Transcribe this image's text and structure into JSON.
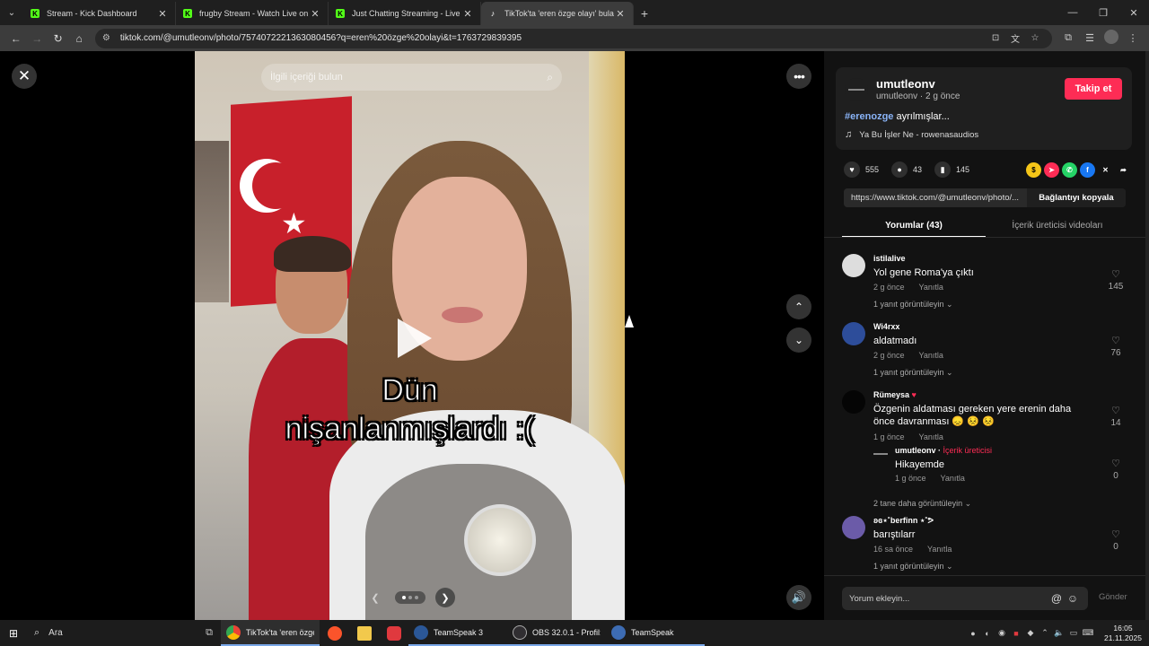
{
  "browser": {
    "tabs": [
      {
        "title": "Stream - Kick Dashboard",
        "favicon": "kick-icon",
        "active": false
      },
      {
        "title": "frugby Stream - Watch Live on",
        "favicon": "kick-icon",
        "active": false
      },
      {
        "title": "Just Chatting Streaming - Live",
        "favicon": "kick-icon",
        "active": false
      },
      {
        "title": "TikTok'ta 'eren özge olayı' bula",
        "favicon": "tiktok-icon",
        "active": true
      }
    ],
    "url": "tiktok.com/@umutleonv/photo/7574072221363080456?q=eren%20özge%20olayi&t=1763729839395"
  },
  "viewer": {
    "search_placeholder": "İlgili içeriği bulun",
    "caption_line1": "Dün",
    "caption_line2": "nişanlanmışlardı :("
  },
  "post": {
    "author": "umutleonv",
    "author_meta": "umutleonv · 2 g önce",
    "follow_label": "Takip et",
    "hashtag": "#erenozge",
    "description": " ayrılmışlar...",
    "music": "Ya Bu İşler Ne - rowenasaudios",
    "likes": "555",
    "comments": "43",
    "saves": "145",
    "link": "https://www.tiktok.com/@umutleonv/photo/...",
    "copy_label": "Bağlantıyı kopyala",
    "tab_comments": "Yorumlar (43)",
    "tab_creator": "İçerik üreticisi videoları"
  },
  "comments": [
    {
      "user": "istilalive",
      "text": "Yol gene Roma'ya çıktı",
      "time": "2 g önce",
      "reply": "Yanıtla",
      "likes": "145",
      "view_replies": "1 yanıt görüntüleyin ⌄"
    },
    {
      "user": "Wi4rxx",
      "text": "aldatmadı",
      "time": "2 g önce",
      "reply": "Yanıtla",
      "likes": "76",
      "view_replies": "1 yanıt görüntüleyin ⌄"
    },
    {
      "user": "Rümeysa",
      "text": "Özgenin aldatması gereken yere erenin daha önce davranması 😞 😣 😣",
      "time": "1 g önce",
      "reply": "Yanıtla",
      "likes": "14",
      "view_replies": "2 tane daha görüntüleyin ⌄"
    },
    {
      "user": "ʚɞ⋆˚berfinn ⋆˚ᕗ",
      "text": "barıştılarr",
      "time": "16 sa önce",
      "reply": "Yanıtla",
      "likes": "0",
      "view_replies": "1 yanıt görüntüleyin ⌄"
    }
  ],
  "creator_reply": {
    "user": "umutleonv",
    "badge": "İçerik üreticisi",
    "text": "Hikayemde",
    "time": "1 g önce",
    "reply": "Yanıtla",
    "likes": "0"
  },
  "add_comment": {
    "placeholder": "Yorum ekleyin...",
    "send_label": "Gönder"
  },
  "taskbar": {
    "search_label": "Ara",
    "apps": [
      {
        "label": "TikTok'ta 'eren özge...",
        "icon": "chrome-icon"
      },
      {
        "label": "",
        "icon": "brave-icon"
      },
      {
        "label": "",
        "icon": "folder-icon"
      },
      {
        "label": "",
        "icon": "red-app-icon"
      },
      {
        "label": "TeamSpeak 3",
        "icon": "teamspeak-icon"
      },
      {
        "label": "OBS 32.0.1 - Profil: l...",
        "icon": "obs-icon"
      },
      {
        "label": "TeamSpeak",
        "icon": "teamspeak-icon"
      }
    ],
    "time": "16:05",
    "date": "21.11.2025"
  },
  "colors": {
    "accent": "#fe2c55",
    "hashtag": "#8ab4f8",
    "panel_bg": "#121212"
  }
}
